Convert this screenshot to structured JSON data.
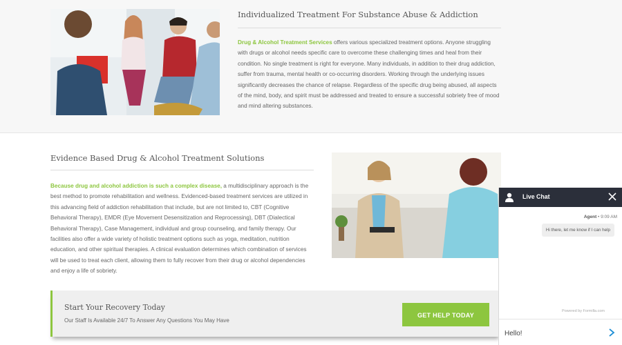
{
  "section1": {
    "heading": "Individualized Treatment For Substance Abuse & Addiction",
    "highlight": "Drug & Alcohol Treatment Services",
    "body": " offers various specialized treatment options. Anyone struggling with drugs or alcohol needs specific care to overcome these challenging times and heal from their condition. No single treatment is right for everyone. Many individuals, in addition to their drug addiction, suffer from trauma, mental health or co-occurring disorders. Working through the underlying issues significantly decreases the chance of  relapse. Regardless of the specific drug being abused, all aspects of the mind, body, and spirit must be addressed and treated to ensure a successful sobriety free of mood and mind altering substances."
  },
  "section2": {
    "heading": "Evidence Based Drug & Alcohol Treatment Solutions",
    "highlight": "Because drug and alcohol addiction is such a complex disease,",
    "body": " a multidisciplinary approach is the best method to promote rehabilitation and wellness. Evidenced-based treatment services are utilized in this advancing field of addiction rehabilitation that include, but are not limited to, CBT (Cognitive Behavioral Therapy), EMDR (Eye Movement Desensitization and Reprocessing), DBT (Dialectical Behavioral Therapy), Case Management, individual and group counseling, and family therapy.  Our facilities also offer a wide variety of holistic treatment options such as yoga, meditation, nutrition education, and other spiritual therapies. A clinical evaluation determines which combination of services will be used to treat each client, allowing them to fully recover from their drug or alcohol dependencies and enjoy a life of sobriety."
  },
  "cta": {
    "title": "Start Your Recovery Today",
    "subtitle": "Our Staff Is Available 24/7 To Answer Any Questions You May Have",
    "button": "GET HELP TODAY"
  },
  "chat": {
    "title": "Live Chat",
    "agent": "Agent",
    "time": "9:09 AM",
    "message": "Hi there, let me know if I can help",
    "powered": "Powered by Formilla.com",
    "input_value": "Hello!"
  },
  "colors": {
    "accent": "#8dc63f",
    "chat_header": "#2b2f3a"
  },
  "icons": [
    "user-icon",
    "close-icon",
    "send-chevron-icon"
  ]
}
